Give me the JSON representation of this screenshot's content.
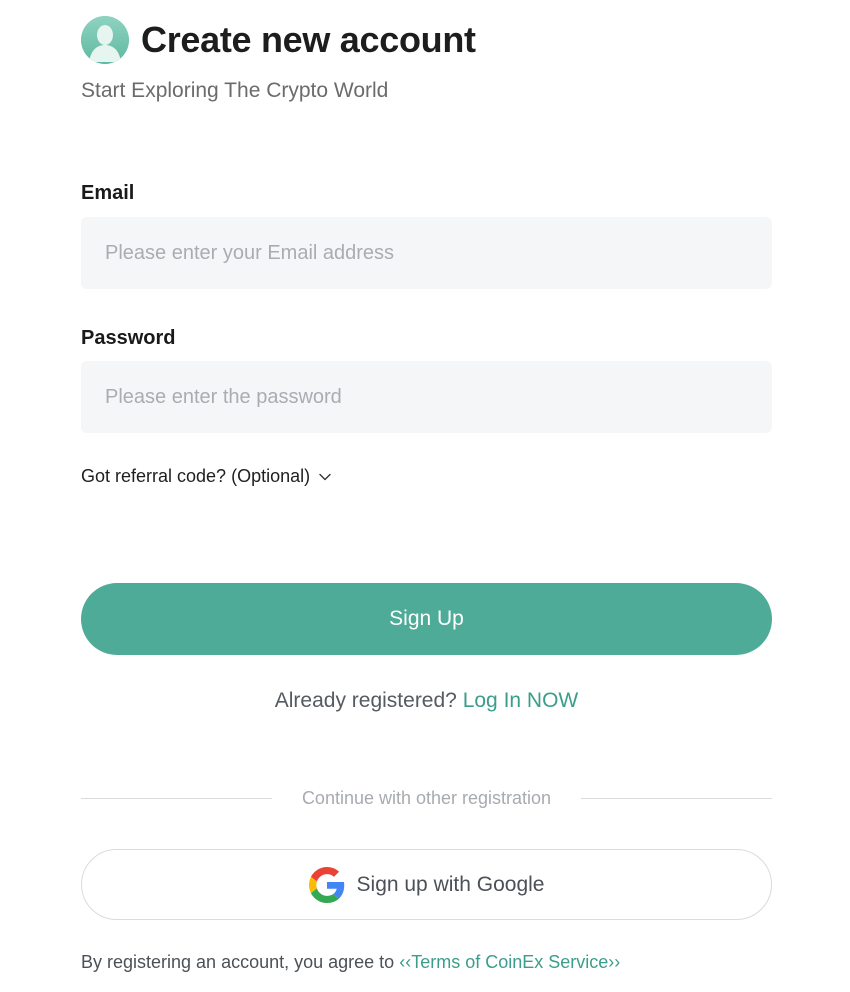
{
  "header": {
    "title": "Create new account",
    "subtitle": "Start Exploring The Crypto World",
    "avatar_icon": "user-avatar-icon"
  },
  "form": {
    "email": {
      "label": "Email",
      "placeholder": "Please enter your Email address",
      "value": ""
    },
    "password": {
      "label": "Password",
      "placeholder": "Please enter the password",
      "value": ""
    },
    "referral_label": "Got referral code? (Optional)",
    "referral_icon": "chevron-down-icon",
    "signup_label": "Sign Up"
  },
  "login": {
    "prompt": "Already registered?",
    "link_label": "Log In NOW"
  },
  "other": {
    "divider_text": "Continue with other registration",
    "google_label": "Sign up with Google",
    "google_icon": "google-icon"
  },
  "terms": {
    "text": "By registering an account, you agree to",
    "link_label": "‹‹Terms of CoinEx Service››"
  },
  "colors": {
    "accent": "#4eab98",
    "link": "#3a9e8a",
    "input_bg": "#f5f6f7"
  }
}
